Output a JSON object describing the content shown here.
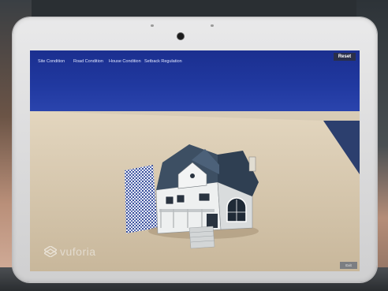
{
  "nav": {
    "items": [
      {
        "label": "Site Condition"
      },
      {
        "label": "Road Condition"
      },
      {
        "label": "House Condition"
      },
      {
        "label": "Setback Regulation"
      }
    ],
    "reset_label": "Reset"
  },
  "ar_view": {
    "watermark_text": "vuforia",
    "exit_label": "Exit",
    "model_icon": "house-model",
    "target_icon": "qr-image-target"
  },
  "colors": {
    "nav_bar": "#20389f",
    "tablet_frame": "#e3e3e4",
    "roof": "#3d4f63",
    "walls": "#eef0f0"
  }
}
